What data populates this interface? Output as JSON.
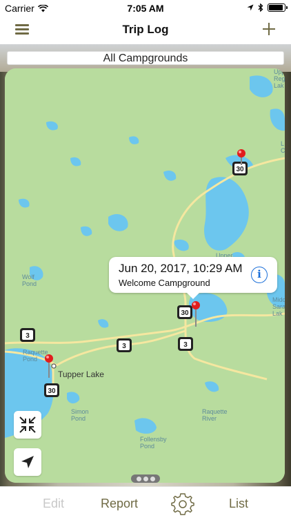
{
  "status_bar": {
    "carrier": "Carrier",
    "time": "7:05 AM"
  },
  "nav": {
    "title": "Trip Log",
    "menu_icon": "hamburger-menu-icon",
    "add_icon": "plus-icon"
  },
  "filter": {
    "label": "All Campgrounds"
  },
  "map": {
    "place_labels": {
      "tupper_lake": "Tupper Lake",
      "wolf_pond": "Wolf\nPond",
      "raquette_pond": "Raquette\nPond",
      "simon_pond": "Simon\nPond",
      "raquette_river": "Raquette\nRiver",
      "follensby_pond": "Follensby\nPond",
      "upper": "Upper",
      "middle_saranac": "Midd\nSara\nLak",
      "regis_lake": "Upp\nReg\nLak",
      "lake_l": "L\nC"
    },
    "route_shields": [
      "30",
      "30",
      "3",
      "3",
      "30",
      "3",
      "30"
    ],
    "callout": {
      "title": "Jun 20, 2017, 10:29 AM",
      "subtitle": "Welcome Campground",
      "icon": "info-icon"
    },
    "controls": {
      "zoom_fit_icon": "collapse-arrows-icon",
      "locate_icon": "location-arrow-icon"
    }
  },
  "tabs": {
    "edit": "Edit",
    "report": "Report",
    "settings_icon": "gear-icon",
    "list": "List"
  },
  "colors": {
    "accent": "#6f6a44",
    "land": "#b8dc9e",
    "water": "#6cc6ee",
    "road": "#f5e7a0",
    "pin": "#e11d1d",
    "info": "#1a6ed8"
  }
}
